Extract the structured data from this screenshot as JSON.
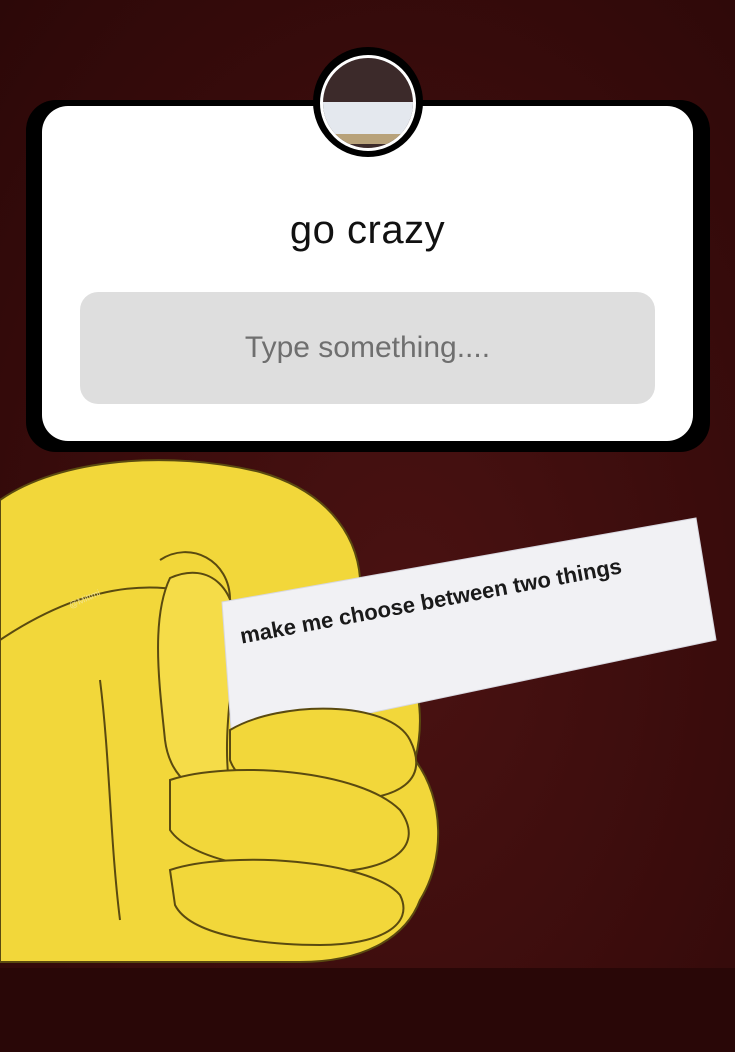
{
  "question_sticker": {
    "prompt": "go crazy",
    "input_placeholder": "Type something...."
  },
  "meme": {
    "paper_text": "make me choose between two things",
    "watermark": "@Mittmi"
  },
  "colors": {
    "background": "#3a0c0c",
    "sticker": "#ffffff",
    "input_box": "#dedede",
    "hand": "#f2d73a"
  },
  "icons": [
    "profile-avatar"
  ]
}
